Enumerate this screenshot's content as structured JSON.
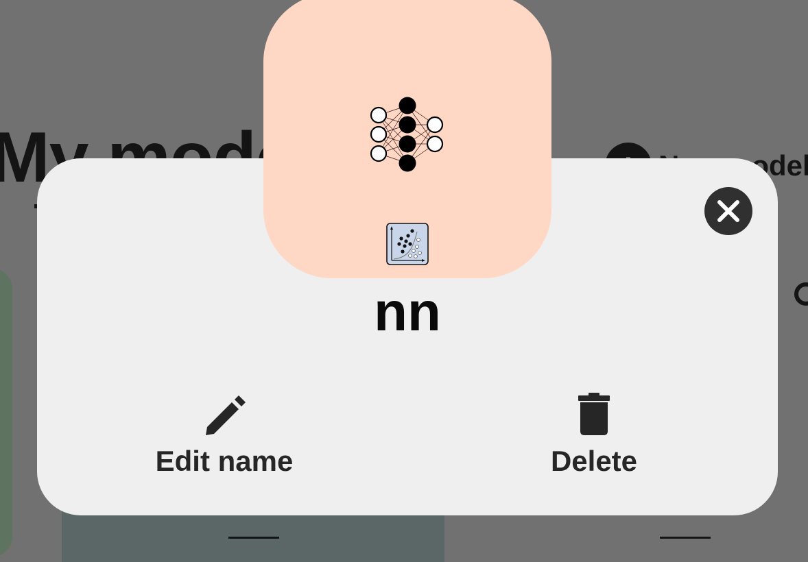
{
  "background": {
    "page_title": "My models",
    "new_model_label": "New model"
  },
  "dialog": {
    "model_name": "nn",
    "edit_label": "Edit name",
    "delete_label": "Delete",
    "tile_color": "#fed8c5",
    "icons": [
      "neural-network-icon",
      "scatter-plot-icon",
      "close-icon",
      "pencil-icon",
      "trash-icon"
    ]
  }
}
